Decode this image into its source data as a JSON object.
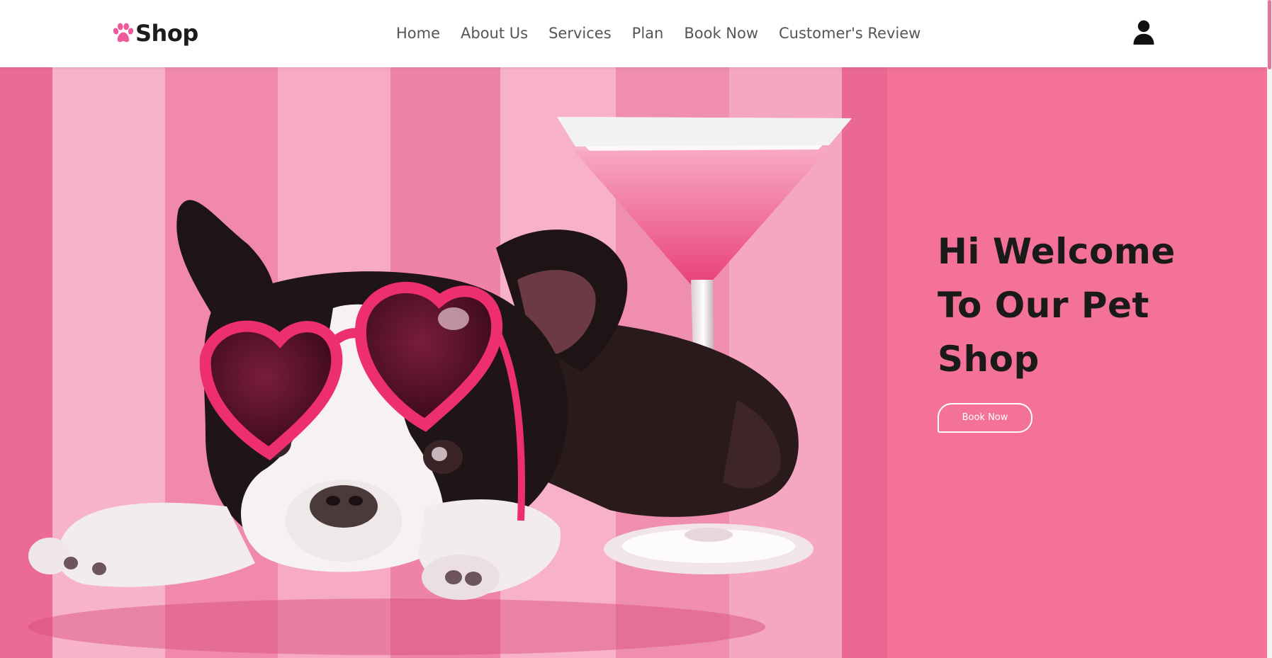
{
  "brand": {
    "name": "Shop",
    "icon": "paw-icon",
    "icon_color": "#ee5a9a"
  },
  "nav": {
    "links": [
      {
        "label": "Home"
      },
      {
        "label": "About Us"
      },
      {
        "label": "Services"
      },
      {
        "label": "Plan"
      },
      {
        "label": "Book Now"
      },
      {
        "label": "Customer's Review"
      }
    ],
    "user_icon": "user-icon"
  },
  "hero": {
    "title_lines": [
      "Hi Welcome",
      "To Our Pet",
      "Shop"
    ],
    "button_label": "Book Now",
    "background_color": "#f47198",
    "image": "boston-terrier-heart-sunglasses-martini-illustration"
  },
  "colors": {
    "accent": "#f47198",
    "nav_text": "#555555",
    "heading": "#1a1a1a",
    "button_text": "#ffffff"
  }
}
